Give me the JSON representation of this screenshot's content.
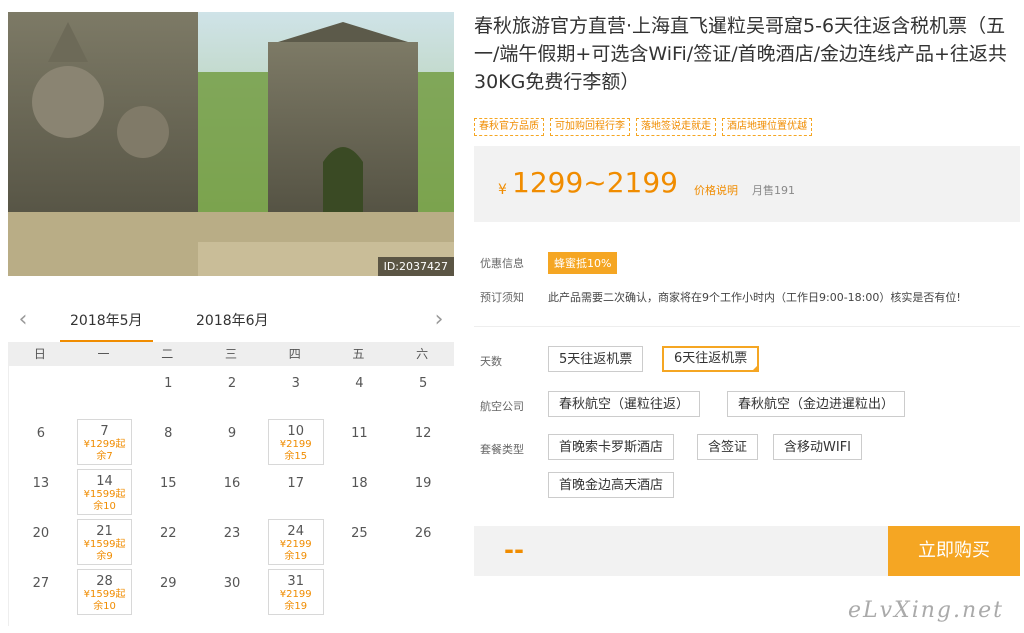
{
  "product": {
    "image_id": "ID:2037427",
    "title": "春秋旅游官方直营·上海直飞暹粒吴哥窟5-6天往返含税机票（五一/端午假期+可选含WiFi/签证/首晚酒店/金边连线产品+往返共30KG免费行李额）",
    "tags": [
      "春秋官方品质",
      "可加购回程行李",
      "落地签说走就走",
      "酒店地理位置优越"
    ],
    "currency_symbol": "¥",
    "price_range": "1299~2199",
    "price_note": "价格说明",
    "monthly_sales": "月售191"
  },
  "info": {
    "discount_label": "优惠信息",
    "discount_badge": "蜂蜜抵10%",
    "notice_label": "预订须知",
    "notice_text": "此产品需要二次确认，商家将在9个工作小时内（工作日9:00-18:00）核实是否有位!"
  },
  "options": {
    "days_label": "天数",
    "days": [
      "5天往返机票",
      "6天往返机票"
    ],
    "days_selected": 1,
    "airline_label": "航空公司",
    "airlines": [
      "春秋航空（暹粒往返）",
      "春秋航空（金边进暹粒出）"
    ],
    "package_label": "套餐类型",
    "packages": [
      "首晚索卡罗斯酒店",
      "含签证",
      "含移动WIFI",
      "首晚金边高天酒店"
    ]
  },
  "buy": {
    "price_placeholder": "--",
    "button_label": "立即购买"
  },
  "calendar": {
    "months": [
      "2018年5月",
      "2018年6月"
    ],
    "active_month": 0,
    "weekdays": [
      "日",
      "一",
      "二",
      "三",
      "四",
      "五",
      "六"
    ],
    "weeks": [
      [
        null,
        null,
        {
          "d": "1"
        },
        {
          "d": "2"
        },
        {
          "d": "3"
        },
        {
          "d": "4"
        },
        {
          "d": "5"
        }
      ],
      [
        {
          "d": "6"
        },
        {
          "d": "7",
          "price": "¥1299起",
          "left": "余7"
        },
        {
          "d": "8"
        },
        {
          "d": "9"
        },
        {
          "d": "10",
          "price": "¥2199",
          "left": "余15"
        },
        {
          "d": "11"
        },
        {
          "d": "12"
        }
      ],
      [
        {
          "d": "13"
        },
        {
          "d": "14",
          "price": "¥1599起",
          "left": "余10"
        },
        {
          "d": "15"
        },
        {
          "d": "16"
        },
        {
          "d": "17"
        },
        {
          "d": "18"
        },
        {
          "d": "19"
        }
      ],
      [
        {
          "d": "20"
        },
        {
          "d": "21",
          "price": "¥1599起",
          "left": "余9"
        },
        {
          "d": "22"
        },
        {
          "d": "23"
        },
        {
          "d": "24",
          "price": "¥2199",
          "left": "余19"
        },
        {
          "d": "25"
        },
        {
          "d": "26"
        }
      ],
      [
        {
          "d": "27"
        },
        {
          "d": "28",
          "price": "¥1599起",
          "left": "余10"
        },
        {
          "d": "29"
        },
        {
          "d": "30"
        },
        {
          "d": "31",
          "price": "¥2199",
          "left": "余19"
        },
        null,
        null
      ]
    ]
  },
  "watermark": "eLvXing.net",
  "colors": {
    "accent": "#f5a623",
    "price": "#f08c00",
    "panel": "#f2f2f2"
  }
}
